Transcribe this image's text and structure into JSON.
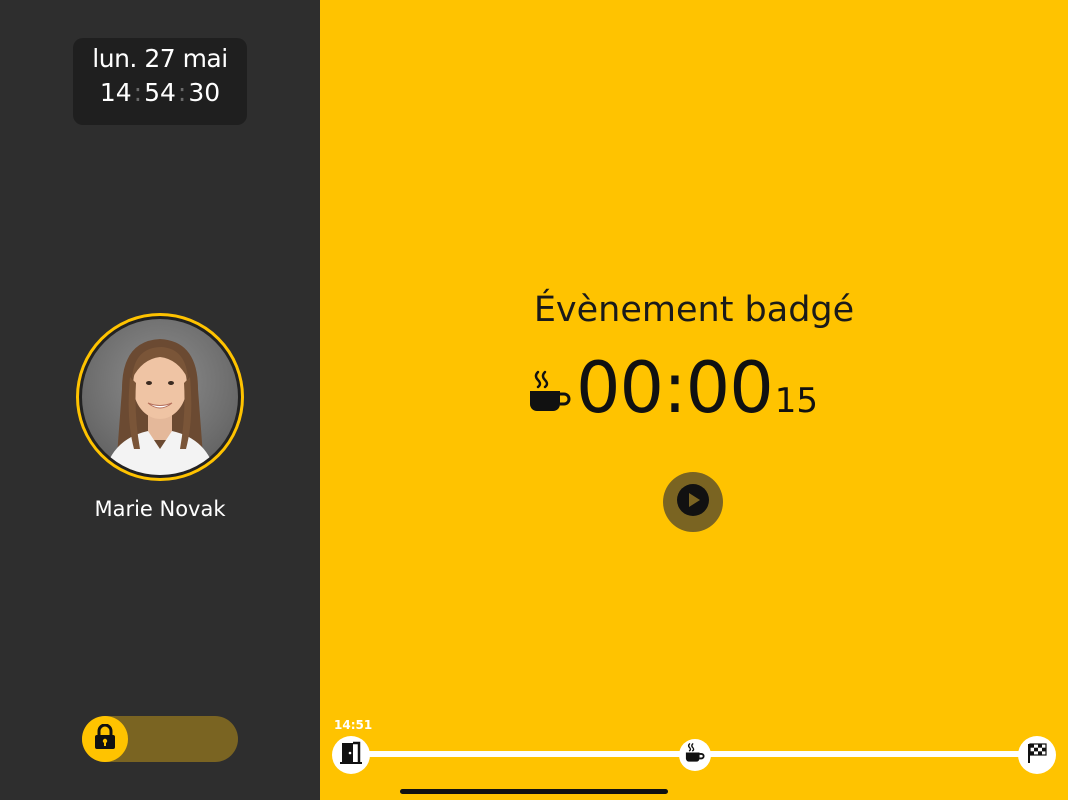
{
  "clock": {
    "date": "lun. 27 mai",
    "hours": "14",
    "minutes": "54",
    "seconds": "30",
    "separator": ":"
  },
  "user": {
    "name": "Marie Novak",
    "avatar_icon": "user-photo"
  },
  "lock": {
    "icon": "lock-icon",
    "state": "locked"
  },
  "event": {
    "title": "Évènement badgé",
    "icon": "coffee-cup-icon",
    "elapsed_main": "00:00",
    "elapsed_seconds": "15",
    "play_icon": "play-icon"
  },
  "timeline": {
    "start_time": "14:51",
    "start_icon": "door-exit-icon",
    "break_icon": "coffee-cup-icon",
    "end_icon": "checkered-flag-icon"
  },
  "colors": {
    "accent": "#ffc300",
    "sidebar": "#2e2e2e",
    "muted_accent": "#7a6422"
  }
}
